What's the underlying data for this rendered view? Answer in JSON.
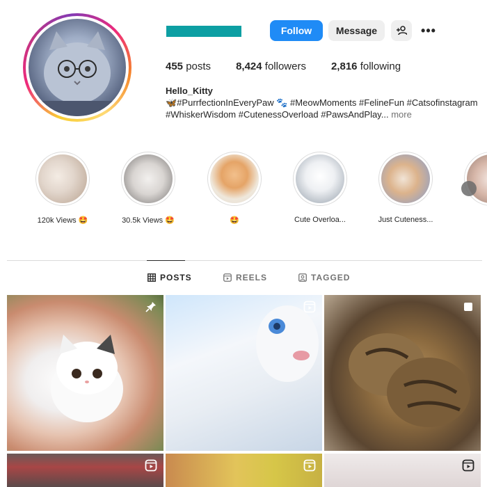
{
  "profile": {
    "follow_label": "Follow",
    "message_label": "Message",
    "suggest_icon": "add-person-icon",
    "more_label": "•••",
    "username_redacted_color": "#0d9fa3"
  },
  "stats": {
    "posts_count": "455",
    "posts_label": "posts",
    "followers_count": "8,424",
    "followers_label": "followers",
    "following_count": "2,816",
    "following_label": "following"
  },
  "bio": {
    "name": "Hello_Kitty",
    "line1": "🦋#PurrfectionInEveryPaw 🐾 #MeowMoments #FelineFun #Catsofinstagram",
    "line2": "#WhiskerWisdom #CutenessOverload #PawsAndPlay...",
    "more_label": "more"
  },
  "highlights": [
    {
      "label": "120k Views 🤩"
    },
    {
      "label": "30.5k Views 🤩"
    },
    {
      "label": "🤩"
    },
    {
      "label": "Cute Overloa..."
    },
    {
      "label": "Just Cuteness..."
    },
    {
      "label": ""
    }
  ],
  "tabs": {
    "posts": "POSTS",
    "reels": "REELS",
    "tagged": "TAGGED",
    "active": "posts"
  },
  "grid": [
    {
      "badge": "pin-icon"
    },
    {
      "badge": "reel-icon"
    },
    {
      "badge": "multi-post-icon"
    },
    {
      "badge": "reel-icon"
    },
    {
      "badge": "reel-icon"
    },
    {
      "badge": "reel-icon"
    }
  ],
  "colors": {
    "accent": "#1f8bf6",
    "text": "#262626",
    "muted": "#737373",
    "border": "#dbdbdb"
  }
}
